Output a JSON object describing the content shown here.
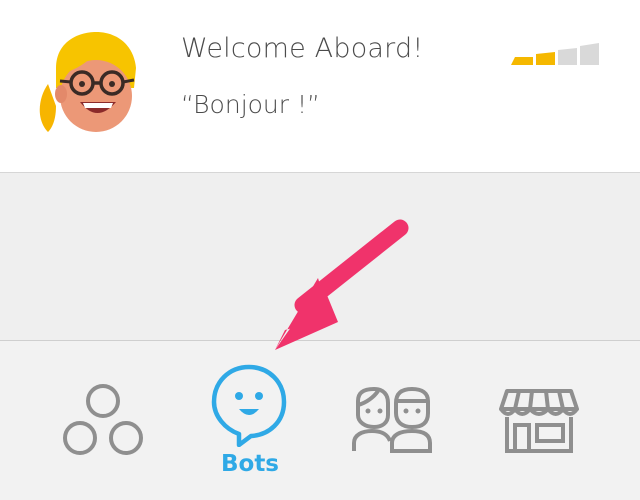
{
  "card": {
    "title": "Welcome Aboard!",
    "subtitle": "“Bonjour !”",
    "strength_level": 2,
    "strength_total": 4,
    "avatar_icon": "bot-avatar-icon"
  },
  "tabs": [
    {
      "name": "circles",
      "label": "",
      "icon": "circles-icon",
      "active": false
    },
    {
      "name": "bots",
      "label": "Bots",
      "icon": "chat-bubble-icon",
      "active": true
    },
    {
      "name": "friends",
      "label": "",
      "icon": "friends-icon",
      "active": false
    },
    {
      "name": "store",
      "label": "",
      "icon": "store-icon",
      "active": false
    }
  ],
  "colors": {
    "accent": "#2fa9e6",
    "arrow": "#f0336b",
    "bar_active": "#f5b800",
    "bar_inactive": "#d9d9d9",
    "icon_gray": "#8f8f8f"
  }
}
